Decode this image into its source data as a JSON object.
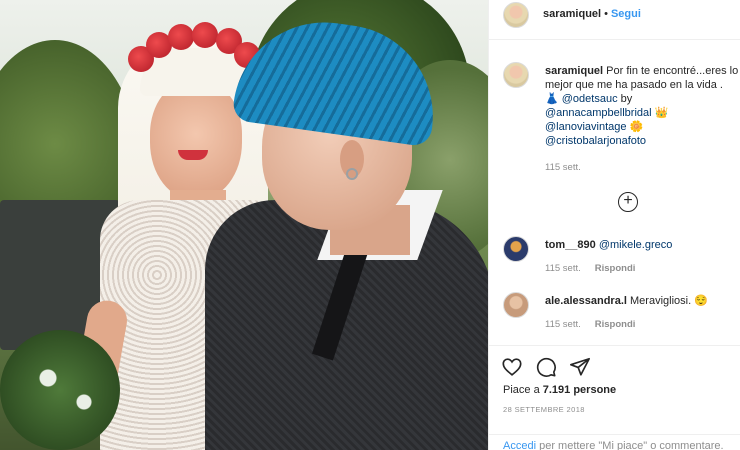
{
  "post": {
    "image_alt": "Wedding photo of a bride with platinum hair and red flower crown beside a groom with a blue mohawk"
  },
  "header": {
    "username": "saramiquel",
    "separator": "•",
    "follow_label": "Segui"
  },
  "caption": {
    "username": "saramiquel",
    "text_lines": [
      "Por fin te encontré...eres lo",
      "mejor que me ha pasado en la vida ."
    ],
    "credits": [
      {
        "prefix": "👗 ",
        "handle": "@odetsauc",
        "suffix": " by"
      },
      {
        "prefix": "",
        "handle": "@annacampbellbridal",
        "suffix": " 👑"
      },
      {
        "prefix": "",
        "handle": "@lanoviavintage",
        "suffix": " 🌼"
      },
      {
        "prefix": "",
        "handle": "@cristobalarjonafoto",
        "suffix": ""
      }
    ],
    "time": "115 sett."
  },
  "comments": [
    {
      "username": "tom__890",
      "text_mention": "@mikele.greco",
      "text": "",
      "time": "115 sett.",
      "reply_label": "Rispondi"
    },
    {
      "username": "ale.alessandra.l",
      "text_mention": "",
      "text": "Meravigliosi. 😌",
      "time": "115 sett.",
      "reply_label": "Rispondi"
    }
  ],
  "actions": {
    "like_icon": "heart-icon",
    "comment_icon": "comment-bubble-icon",
    "share_icon": "paper-plane-icon",
    "likes_prefix": "Piace a ",
    "likes_count": "7.191",
    "likes_suffix": " persone",
    "date": "28 SETTEMBRE 2018"
  },
  "add_comment": {
    "login_link": "Accedi",
    "text": " per mettere \"Mi piace\" o commentare."
  },
  "colors": {
    "link": "#3897f0",
    "mention": "#00376b",
    "muted": "#8e8e8e",
    "text": "#262626",
    "border": "#efefef"
  }
}
